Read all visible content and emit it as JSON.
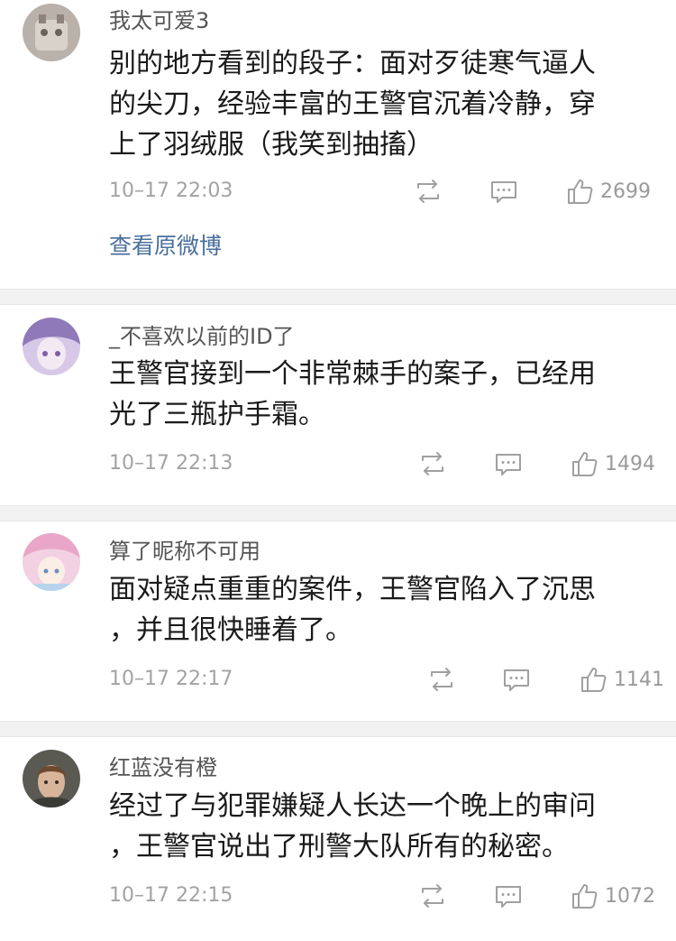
{
  "comments": [
    {
      "username": "我太可爱3",
      "lines": [
        "别的地方看到的段子：面对歹徒寒气逼人",
        "的尖刀，经验丰富的王警官沉着冷静，穿",
        "上了羽绒服（我笑到抽搐）"
      ],
      "time": "10–17 22:03",
      "likes": "2699",
      "view_original": "查看原微博"
    },
    {
      "username": "_不喜欢以前的ID了",
      "lines": [
        "王警官接到一个非常棘手的案子，已经用",
        "光了三瓶护手霜。"
      ],
      "time": "10–17 22:13",
      "likes": "1494"
    },
    {
      "username": "算了昵称不可用",
      "lines": [
        "面对疑点重重的案件，王警官陷入了沉思",
        "，并且很快睡着了。"
      ],
      "time": "10–17 22:17",
      "likes": "1141"
    },
    {
      "username": "红蓝没有橙",
      "lines": [
        "经过了与犯罪嫌疑人长达一个晚上的审问",
        "，王警官说出了刑警大队所有的秘密。"
      ],
      "time": "10–17 22:15",
      "likes": "1072"
    }
  ],
  "icons": {
    "repost": "repost-icon",
    "comment": "comment-icon",
    "like": "thumbs-up-icon"
  },
  "colors": {
    "link": "#4a6f9c",
    "meta": "#a3a3a3",
    "separator": "#f2f2f2"
  }
}
